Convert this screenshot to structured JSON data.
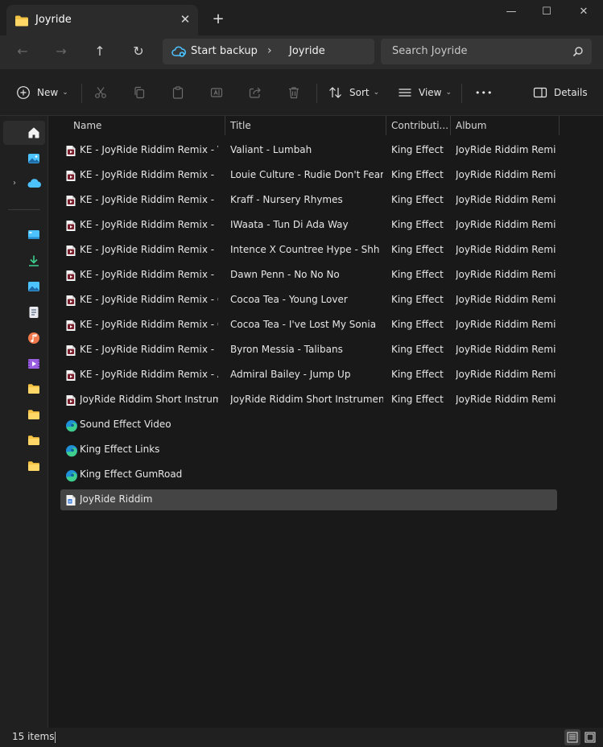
{
  "window": {
    "tab_title": "Joyride",
    "close_tab_glyph": "✕",
    "new_tab_glyph": "+",
    "minimize_glyph": "—",
    "maximize_glyph": "☐",
    "close_glyph": "✕"
  },
  "navigation": {
    "back_glyph": "←",
    "forward_glyph": "→",
    "up_glyph": "↑",
    "refresh_glyph": "↻",
    "breadcrumbs": [
      "Start backup",
      "Joyride"
    ],
    "crumb_separator": "›",
    "search_placeholder": "Search Joyride"
  },
  "toolbar": {
    "new_label": "New",
    "sort_label": "Sort",
    "view_label": "View",
    "more_glyph": "•••",
    "details_label": "Details",
    "chevron_glyph": "⌄"
  },
  "sidebar": {
    "expand_glyph": "›",
    "icons": [
      "home-icon",
      "gallery-icon",
      "onedrive-icon",
      "desktop-icon",
      "downloads-icon",
      "pictures-icon",
      "documents-icon",
      "music-icon",
      "videos-icon",
      "folder-icon",
      "folder-icon",
      "folder-icon",
      "folder-icon"
    ]
  },
  "columns": {
    "name": "Name",
    "title": "Title",
    "contributing": "Contributi...",
    "album": "Album"
  },
  "files": [
    {
      "name": "KE - JoyRide Riddim Remix - Va...",
      "title": "Valiant - Lumbah",
      "contributing": "King Effect",
      "album": "JoyRide Riddim Remi...",
      "icon": "audio-file-icon"
    },
    {
      "name": "KE - JoyRide Riddim Remix - L...",
      "title": "Louie Culture - Rudie Don't Fear",
      "contributing": "King Effect",
      "album": "JoyRide Riddim Remi...",
      "icon": "audio-file-icon"
    },
    {
      "name": "KE - JoyRide Riddim Remix - Kr...",
      "title": "Kraff - Nursery Rhymes",
      "contributing": "King Effect",
      "album": "JoyRide Riddim Remi...",
      "icon": "audio-file-icon"
    },
    {
      "name": "KE - JoyRide Riddim Remix - I...",
      "title": "IWaata - Tun Di Ada Way",
      "contributing": "King Effect",
      "album": "JoyRide Riddim Remi...",
      "icon": "audio-file-icon"
    },
    {
      "name": "KE - JoyRide Riddim Remix - In...",
      "title": "Intence X Countree Hype - Shh",
      "contributing": "King Effect",
      "album": "JoyRide Riddim Remi...",
      "icon": "audio-file-icon"
    },
    {
      "name": "KE - JoyRide Riddim Remix - D...",
      "title": "Dawn Penn - No No No",
      "contributing": "King Effect",
      "album": "JoyRide Riddim Remi...",
      "icon": "audio-file-icon"
    },
    {
      "name": "KE - JoyRide Riddim Remix - C...",
      "title": "Cocoa Tea - Young Lover",
      "contributing": "King Effect",
      "album": "JoyRide Riddim Remi...",
      "icon": "audio-file-icon"
    },
    {
      "name": "KE - JoyRide Riddim Remix - C...",
      "title": "Cocoa Tea - I've Lost My Sonia",
      "contributing": "King Effect",
      "album": "JoyRide Riddim Remi...",
      "icon": "audio-file-icon"
    },
    {
      "name": "KE - JoyRide Riddim Remix - B...",
      "title": "Byron Messia - Talibans",
      "contributing": "King Effect",
      "album": "JoyRide Riddim Remi...",
      "icon": "audio-file-icon"
    },
    {
      "name": "KE - JoyRide Riddim Remix - A...",
      "title": "Admiral Bailey - Jump Up",
      "contributing": "King Effect",
      "album": "JoyRide Riddim Remi...",
      "icon": "audio-file-icon"
    },
    {
      "name": "JoyRide Riddim Short Instrume...",
      "title": "JoyRide Riddim Short Instrumental",
      "contributing": "King Effect",
      "album": "JoyRide Riddim Remi...",
      "icon": "audio-file-icon"
    },
    {
      "name": "Sound Effect Video",
      "title": "",
      "contributing": "",
      "album": "",
      "icon": "edge-link-icon"
    },
    {
      "name": "King Effect Links",
      "title": "",
      "contributing": "",
      "album": "",
      "icon": "edge-link-icon"
    },
    {
      "name": "King Effect GumRoad",
      "title": "",
      "contributing": "",
      "album": "",
      "icon": "edge-link-icon"
    },
    {
      "name": "JoyRide Riddim",
      "title": "",
      "contributing": "",
      "album": "",
      "icon": "document-icon",
      "selected": true
    }
  ],
  "status": {
    "item_count": "15 items"
  },
  "colors": {
    "folder": "#f5c344",
    "accent_blue": "#4cc2ff",
    "downloads_green": "#3ecf8e",
    "music_orange": "#f0784a",
    "videos_purple": "#9a5fe0"
  }
}
